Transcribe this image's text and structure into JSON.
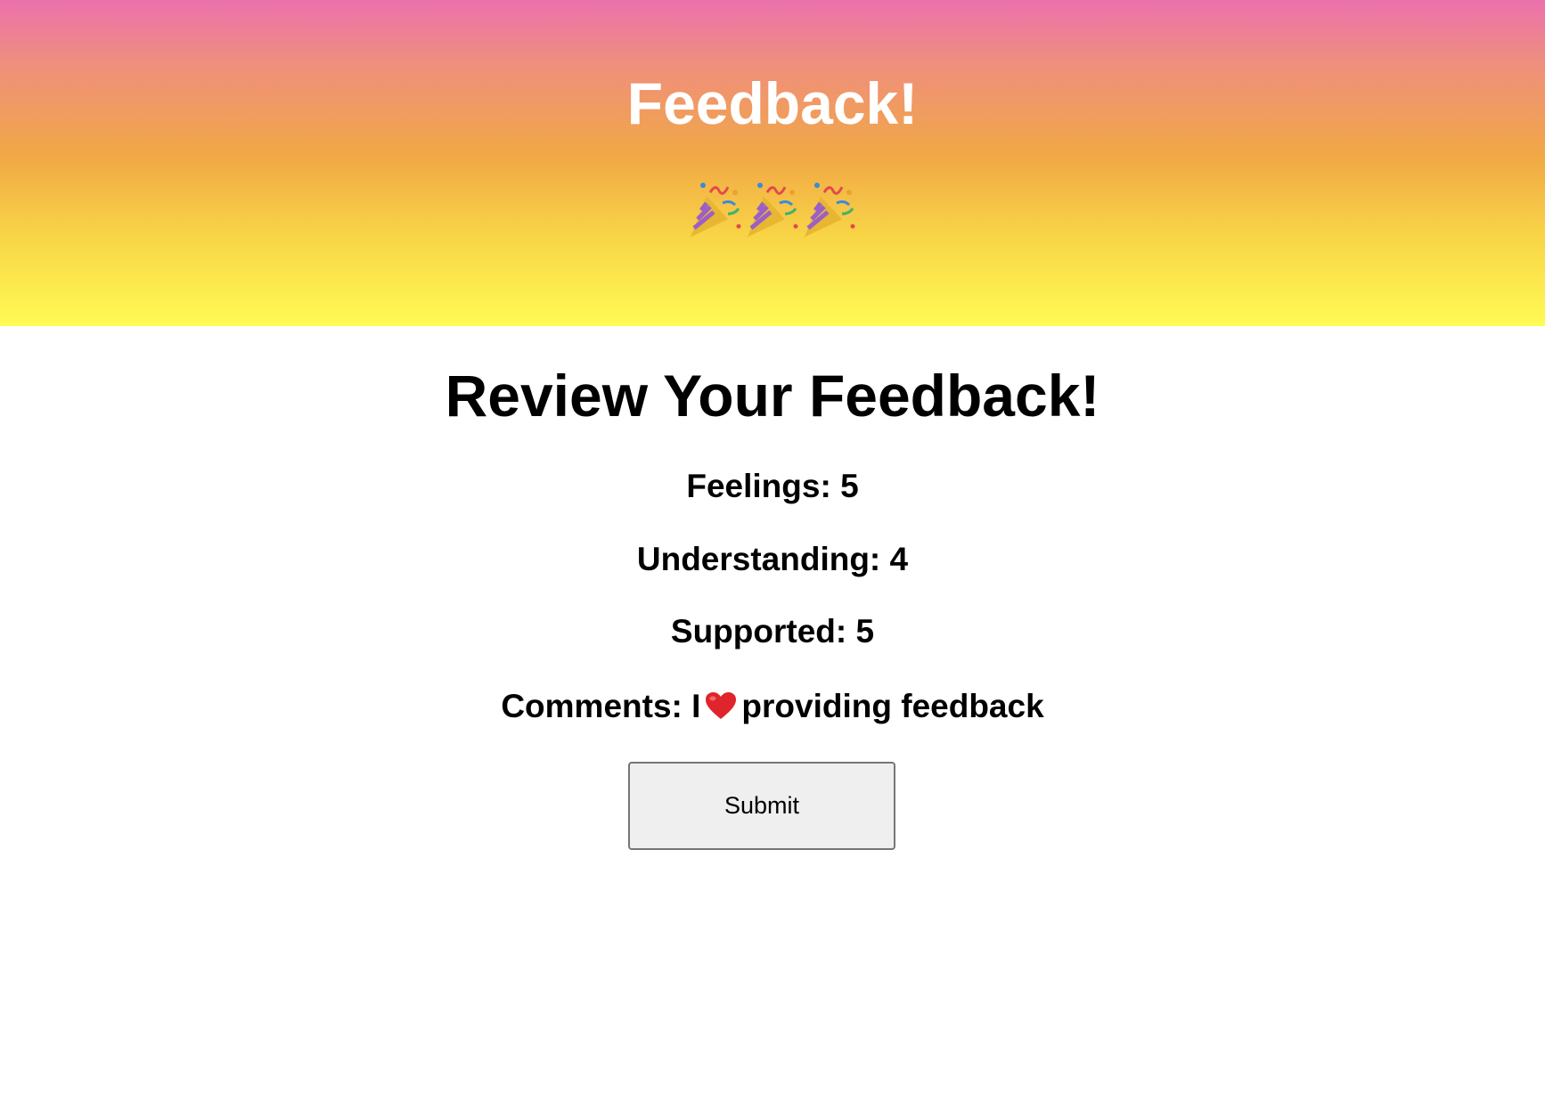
{
  "header": {
    "title": "Feedback!",
    "emoji": [
      "party-popper-icon",
      "party-popper-icon",
      "party-popper-icon"
    ],
    "gradient_colors": [
      "#ec71ae",
      "#f1a845",
      "#fffb54"
    ]
  },
  "review": {
    "title": "Review Your Feedback!",
    "feelings": {
      "label": "Feelings:",
      "value": "5"
    },
    "understanding": {
      "label": "Understanding:",
      "value": "4"
    },
    "supported": {
      "label": "Supported:",
      "value": "5"
    },
    "comments": {
      "label": "Comments:",
      "prefix": "I",
      "icon": "heart-icon",
      "suffix": "providing feedback"
    }
  },
  "actions": {
    "submit_label": "Submit"
  }
}
